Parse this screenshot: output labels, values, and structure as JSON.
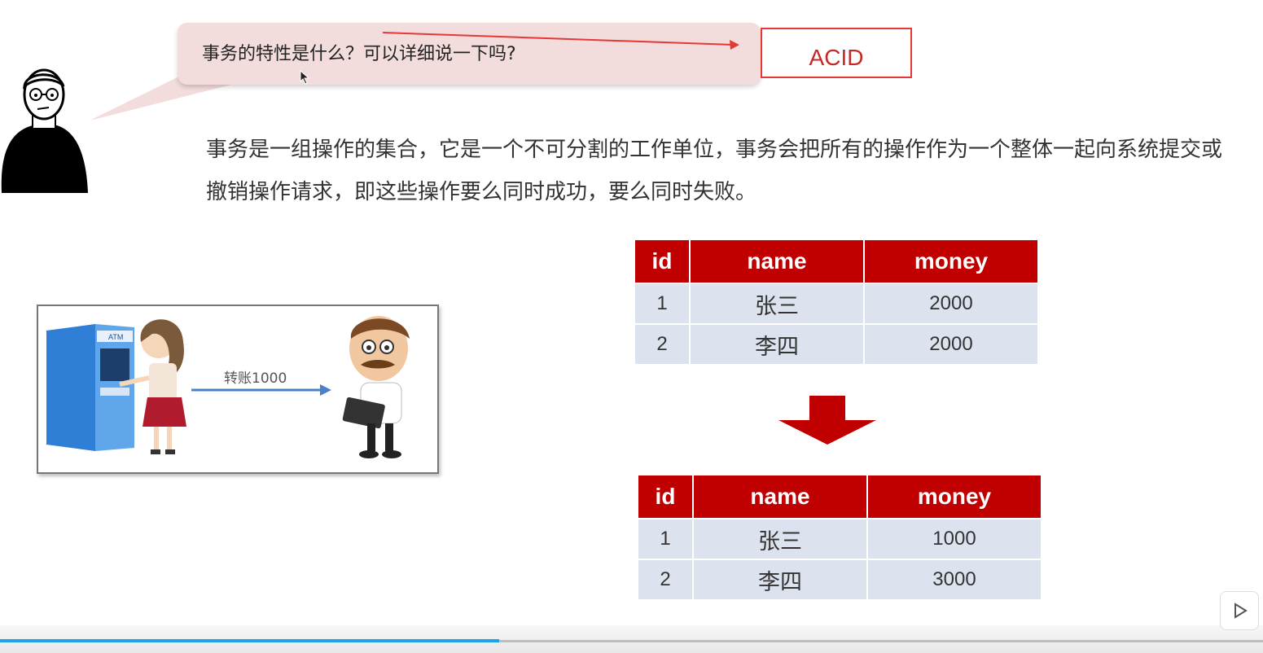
{
  "question": "事务的特性是什么？可以详细说一下吗?",
  "answer_box": "ACID",
  "definition": "事务是一组操作的集合，它是一个不可分割的工作单位，事务会把所有的操作作为一个整体一起向系统提交或撤销操作请求，即这些操作要么同时成功，要么同时失败。",
  "illustration": {
    "atm_label": "ATM",
    "transfer_label": "转账1000"
  },
  "table_before": {
    "headers": [
      "id",
      "name",
      "money"
    ],
    "rows": [
      [
        "1",
        "张三",
        "2000"
      ],
      [
        "2",
        "李四",
        "2000"
      ]
    ]
  },
  "table_after": {
    "headers": [
      "id",
      "name",
      "money"
    ],
    "rows": [
      [
        "1",
        "张三",
        "1000"
      ],
      [
        "2",
        "李四",
        "3000"
      ]
    ]
  },
  "player": {
    "progress": 0.395
  },
  "colors": {
    "table_header": "#c00000",
    "table_cell": "#dde3ee",
    "answer_border": "#e53935",
    "bubble": "#f3dcdc",
    "progress": "#1aa3e8"
  },
  "icons": [
    "cursor-icon",
    "avatar-icon",
    "down-arrow-icon",
    "play-icon",
    "right-arrow-icon"
  ]
}
